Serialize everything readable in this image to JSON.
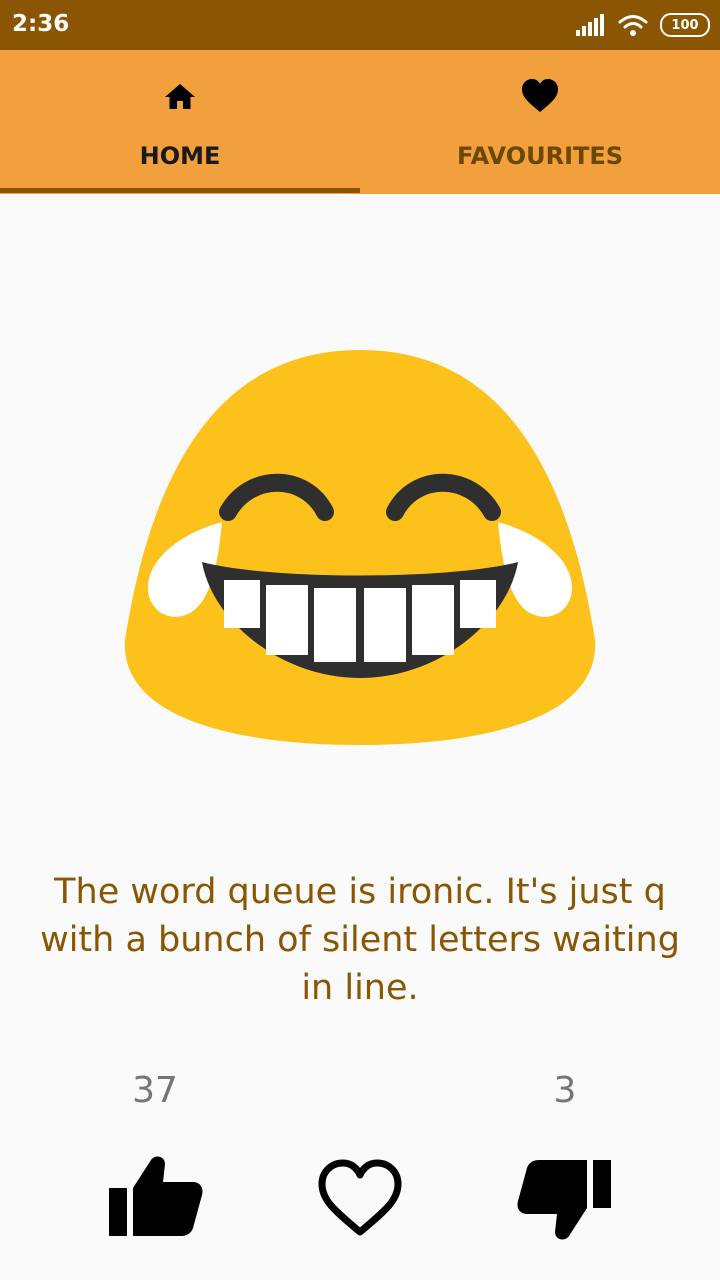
{
  "status_bar": {
    "time": "2:36",
    "battery": "100",
    "signal_icon": "signal-icon",
    "wifi_icon": "wifi-icon"
  },
  "tabs": [
    {
      "label": "HOME",
      "icon": "home-icon",
      "selected": true
    },
    {
      "label": "FAVOURITES",
      "icon": "heart-icon",
      "selected": false
    }
  ],
  "joke": {
    "emoji": "face-with-tears-of-joy",
    "text": "The word queue is ironic. It's just q with a bunch of silent letters waiting in line."
  },
  "votes": {
    "likes": "37",
    "dislikes": "3"
  },
  "actions": {
    "like_icon": "thumbs-up-icon",
    "favourite_icon": "heart-outline-icon",
    "dislike_icon": "thumbs-down-icon"
  },
  "colors": {
    "status_bar": "#8A5604",
    "tab_bar": "#F2A03D",
    "accent_text": "#8A5604",
    "emoji_yellow": "#FCC21B"
  }
}
